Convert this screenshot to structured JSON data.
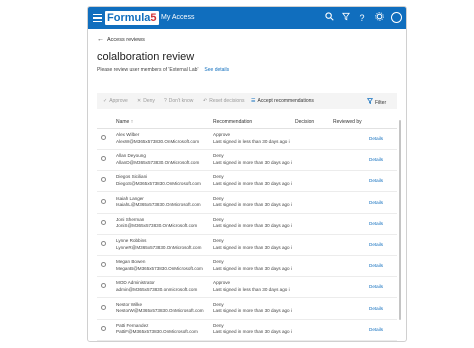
{
  "header": {
    "logo_text": "Formula",
    "logo_number": "5",
    "app_name": "My Access",
    "icons": [
      "search-icon",
      "filter-icon",
      "help-icon",
      "settings-icon",
      "avatar"
    ]
  },
  "breadcrumb": {
    "back_label": "Access reviews"
  },
  "page": {
    "title": "colalboration review",
    "subtitle": "Please review user members of 'External Lab'",
    "see_details": "See details"
  },
  "toolbar": {
    "approve": "Approve",
    "deny": "Deny",
    "dont_know": "Don't know",
    "reset": "Reset decisions",
    "accept": "Accept recommendations",
    "filter": "Filter"
  },
  "table": {
    "headers": {
      "name": "Name ↑",
      "recommendation": "Recommendation",
      "decision": "Decision",
      "reviewed_by": "Reviewed by"
    },
    "details_label": "Details",
    "rows": [
      {
        "name": "Alex Wilber",
        "email": "AlexW@M365x573830.OnMicrosoft.com",
        "rec": "Approve",
        "reason": "Last signed in less than 30 days ago i"
      },
      {
        "name": "Allan Deyoung",
        "email": "AllanD@M365x573830.OnMicrosoft.com",
        "rec": "Deny",
        "reason": "Last signed in more than 30 days ago i"
      },
      {
        "name": "Diegos Siciliani",
        "email": "DiegoS@M365x573830.OnMicrosoft.com",
        "rec": "Deny",
        "reason": "Last signed in more than 30 days ago i"
      },
      {
        "name": "Isaiah Langer",
        "email": "IsaiahL@M365x573830.OnMicrosoft.com",
        "rec": "Deny",
        "reason": "Last signed in more than 30 days ago i"
      },
      {
        "name": "Joni Sherman",
        "email": "JoniS@M365x573830.OnMicrosoft.com",
        "rec": "Deny",
        "reason": "Last signed in more than 30 days ago i"
      },
      {
        "name": "Lynne Robbins",
        "email": "LynneR@M365x573830.OnMicrosoft.com",
        "rec": "Deny",
        "reason": "Last signed in more than 30 days ago i"
      },
      {
        "name": "Megan Bowen",
        "email": "MeganB@M365x573830.OnMicrosoft.com",
        "rec": "Deny",
        "reason": "Last signed in more than 30 days ago i"
      },
      {
        "name": "MOD Administrator",
        "email": "admin@M365x573830.onmicrosoft.com",
        "rec": "Approve",
        "reason": "Last signed in less than 30 days ago i"
      },
      {
        "name": "Nestor Wilke",
        "email": "NestorW@M365x573830.OnMicrosoft.com",
        "rec": "Deny",
        "reason": "Last signed in more than 30 days ago i"
      },
      {
        "name": "Patti Fernandez",
        "email": "PattiF@M365x573830.OnMicrosoft.com",
        "rec": "Deny",
        "reason": "Last signed in more than 30 days ago i"
      }
    ]
  },
  "colors": {
    "brand": "#106ebe",
    "accent": "#d13438"
  }
}
